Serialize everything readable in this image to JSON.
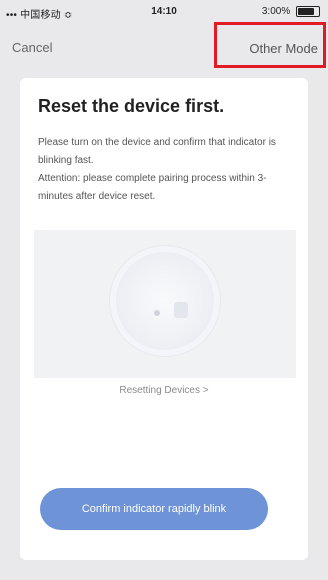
{
  "status_bar": {
    "carrier": "••• 中国移动 ≎",
    "time": "14:10",
    "battery_text": "3:00%"
  },
  "nav": {
    "cancel_label": "Cancel",
    "other_mode_label": "Other Mode"
  },
  "card": {
    "title": "Reset the device first.",
    "description_1": "Please turn on the device and confirm that indicator is blinking fast.",
    "description_2": "Attention: please complete pairing process within 3-minutes after device reset.",
    "reset_link": "Resetting Devices >",
    "confirm_label": "Confirm indicator rapidly blink"
  },
  "colors": {
    "highlight": "#e01b24",
    "button": "#6e93d6"
  }
}
